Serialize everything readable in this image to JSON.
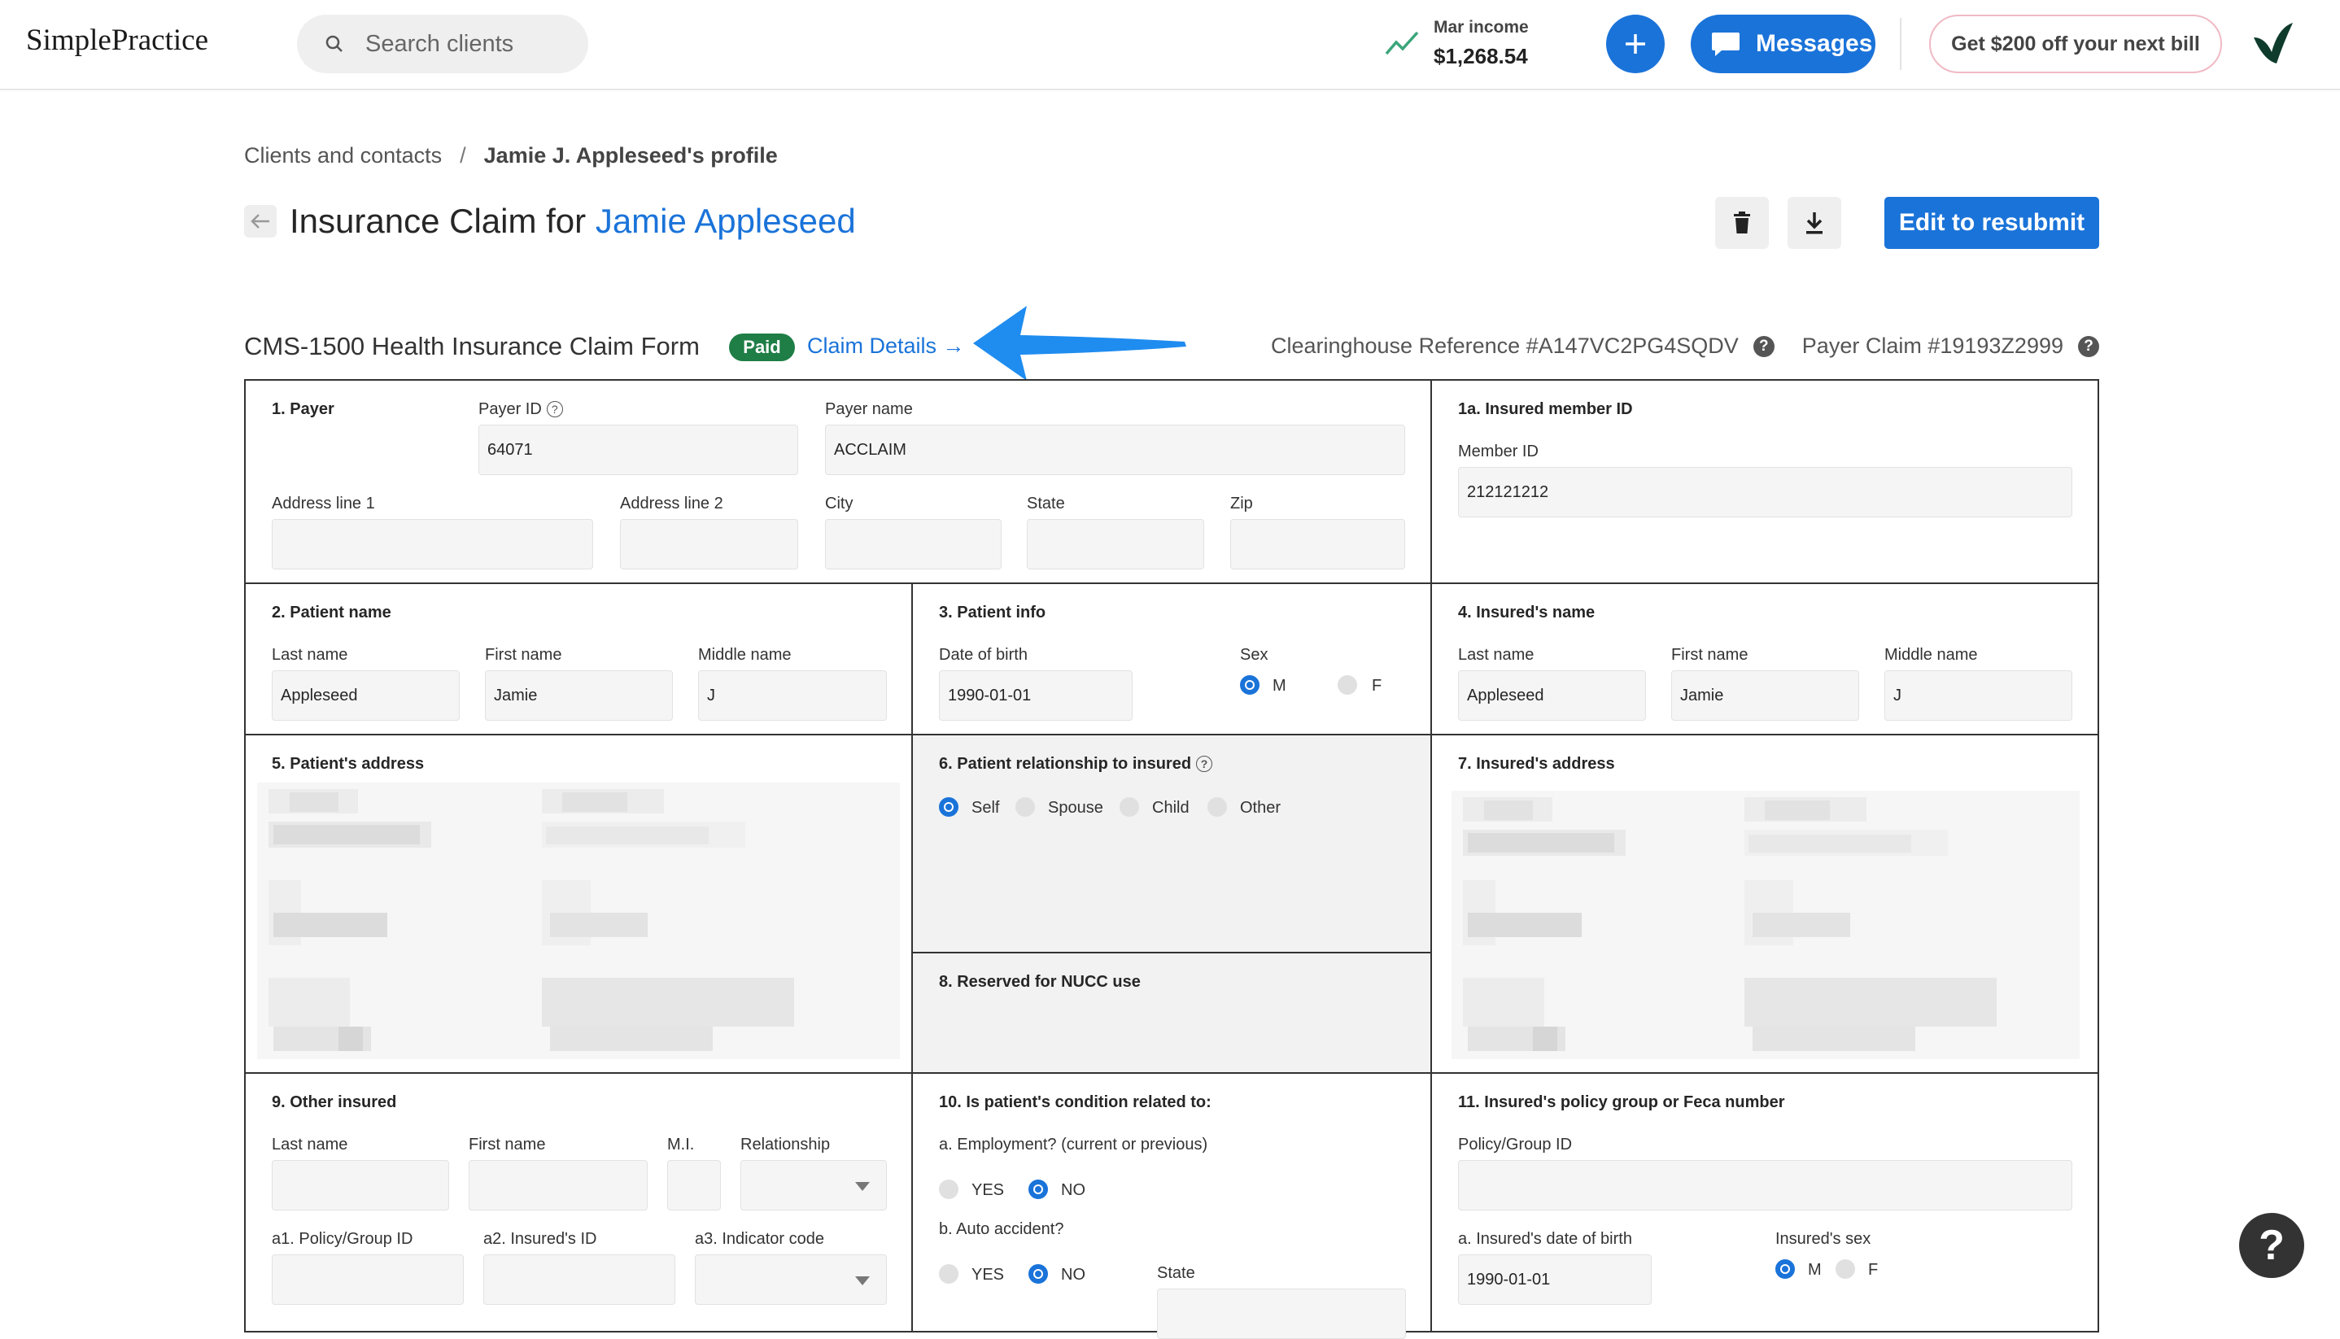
{
  "app": {
    "logo": "SimplePractice"
  },
  "header": {
    "search_placeholder": "Search clients",
    "income_label": "Mar income",
    "income_value": "$1,268.54",
    "messages_label": "Messages",
    "promo_label": "Get $200 off your next bill"
  },
  "breadcrumb": {
    "parent": "Clients and contacts",
    "separator": "/",
    "current": "Jamie J. Appleseed's profile"
  },
  "page": {
    "title_prefix": "Insurance Claim for ",
    "client_name": "Jamie Appleseed",
    "resubmit_label": "Edit to resubmit"
  },
  "claim": {
    "form_title": "CMS-1500 Health Insurance Claim Form",
    "status": "Paid",
    "details_link": "Claim Details →",
    "clearinghouse_ref": "Clearinghouse Reference #A147VC2PG4SQDV",
    "payer_claim": "Payer Claim #19193Z2999"
  },
  "form": {
    "s1": {
      "title": "1. Payer",
      "payer_id_label": "Payer ID",
      "payer_id": "64071",
      "payer_name_label": "Payer name",
      "payer_name": "ACCLAIM",
      "addr1": "Address line 1",
      "addr2": "Address line 2",
      "city": "City",
      "state": "State",
      "zip": "Zip"
    },
    "s1a": {
      "title": "1a. Insured member ID",
      "member_label": "Member ID",
      "member_id": "212121212"
    },
    "s2": {
      "title": "2. Patient name",
      "last_label": "Last name",
      "last": "Appleseed",
      "first_label": "First name",
      "first": "Jamie",
      "middle_label": "Middle name",
      "middle": "J"
    },
    "s3": {
      "title": "3. Patient info",
      "dob_label": "Date of birth",
      "dob": "1990-01-01",
      "sex_label": "Sex",
      "m": "M",
      "f": "F"
    },
    "s4": {
      "title": "4. Insured's name",
      "last_label": "Last name",
      "last": "Appleseed",
      "first_label": "First name",
      "first": "Jamie",
      "middle_label": "Middle name",
      "middle": "J"
    },
    "s5": {
      "title": "5. Patient's address"
    },
    "s6": {
      "title": "6. Patient relationship to insured",
      "self": "Self",
      "spouse": "Spouse",
      "child": "Child",
      "other": "Other"
    },
    "s7": {
      "title": "7. Insured's address"
    },
    "s8": {
      "title": "8. Reserved for NUCC use"
    },
    "s9": {
      "title": "9. Other insured",
      "last_label": "Last name",
      "first_label": "First name",
      "mi_label": "M.I.",
      "rel_label": "Relationship",
      "a1": "a1. Policy/Group ID",
      "a2": "a2. Insured's ID",
      "a3": "a3. Indicator code"
    },
    "s10": {
      "title": "10. Is patient's condition related to:",
      "employment": "a. Employment? (current or previous)",
      "auto": "b. Auto accident?",
      "yes": "YES",
      "no": "NO",
      "state": "State"
    },
    "s11": {
      "title": "11. Insured's policy group or Feca number",
      "policy_label": "Policy/Group ID",
      "dob_label": "a. Insured's date of birth",
      "dob": "1990-01-01",
      "sex_label": "Insured's sex",
      "m": "M",
      "f": "F"
    }
  },
  "help_label": "?"
}
